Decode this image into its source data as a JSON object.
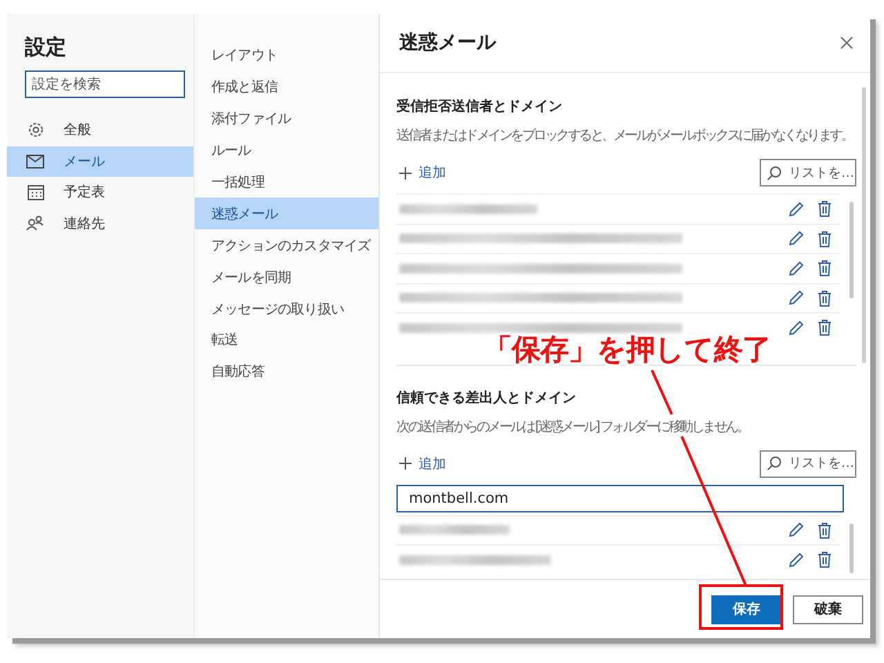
{
  "nav": {
    "title": "設定",
    "search": {
      "placeholder": "設定を検索"
    },
    "items": [
      {
        "label": "全般",
        "selected": false
      },
      {
        "label": "メール",
        "selected": true
      },
      {
        "label": "予定表",
        "selected": false
      },
      {
        "label": "連絡先",
        "selected": false
      }
    ]
  },
  "subnav": {
    "items": [
      {
        "label": "レイアウト",
        "selected": false
      },
      {
        "label": "作成と返信",
        "selected": false
      },
      {
        "label": "添付ファイル",
        "selected": false
      },
      {
        "label": "ルール",
        "selected": false
      },
      {
        "label": "一括処理",
        "selected": false
      },
      {
        "label": "迷惑メール",
        "selected": true
      },
      {
        "label": "アクションのカスタマイズ",
        "selected": false
      },
      {
        "label": "メールを同期",
        "selected": false
      },
      {
        "label": "メッセージの取り扱い",
        "selected": false
      },
      {
        "label": "転送",
        "selected": false
      },
      {
        "label": "自動応答",
        "selected": false
      }
    ]
  },
  "panel": {
    "title": "迷惑メール",
    "sections": [
      {
        "heading": "受信拒否送信者とドメイン",
        "description": "送信者またはドメインをブロックすると、メールがメールボックスに届かなくなります。",
        "add": "追加",
        "list_button": "リストを…",
        "rows": [
          {
            "kind": "redacted"
          },
          {
            "kind": "redacted"
          },
          {
            "kind": "redacted"
          },
          {
            "kind": "redacted"
          },
          {
            "kind": "redacted"
          }
        ]
      },
      {
        "heading": "信頼できる差出人とドメイン",
        "description": "次の送信者からのメールは [迷惑メール] フォルダーに移動しません。",
        "add": "追加",
        "list_button": "リストを…",
        "entry": {
          "value": "montbell.com"
        },
        "rows": [
          {
            "kind": "redacted"
          },
          {
            "kind": "redacted"
          }
        ]
      }
    ]
  },
  "footer": {
    "buttons": [
      {
        "label": "保存",
        "kind": "primary"
      },
      {
        "label": "破棄",
        "kind": "secondary"
      }
    ]
  },
  "annotation": {
    "text": "「保存」を押して終了"
  }
}
